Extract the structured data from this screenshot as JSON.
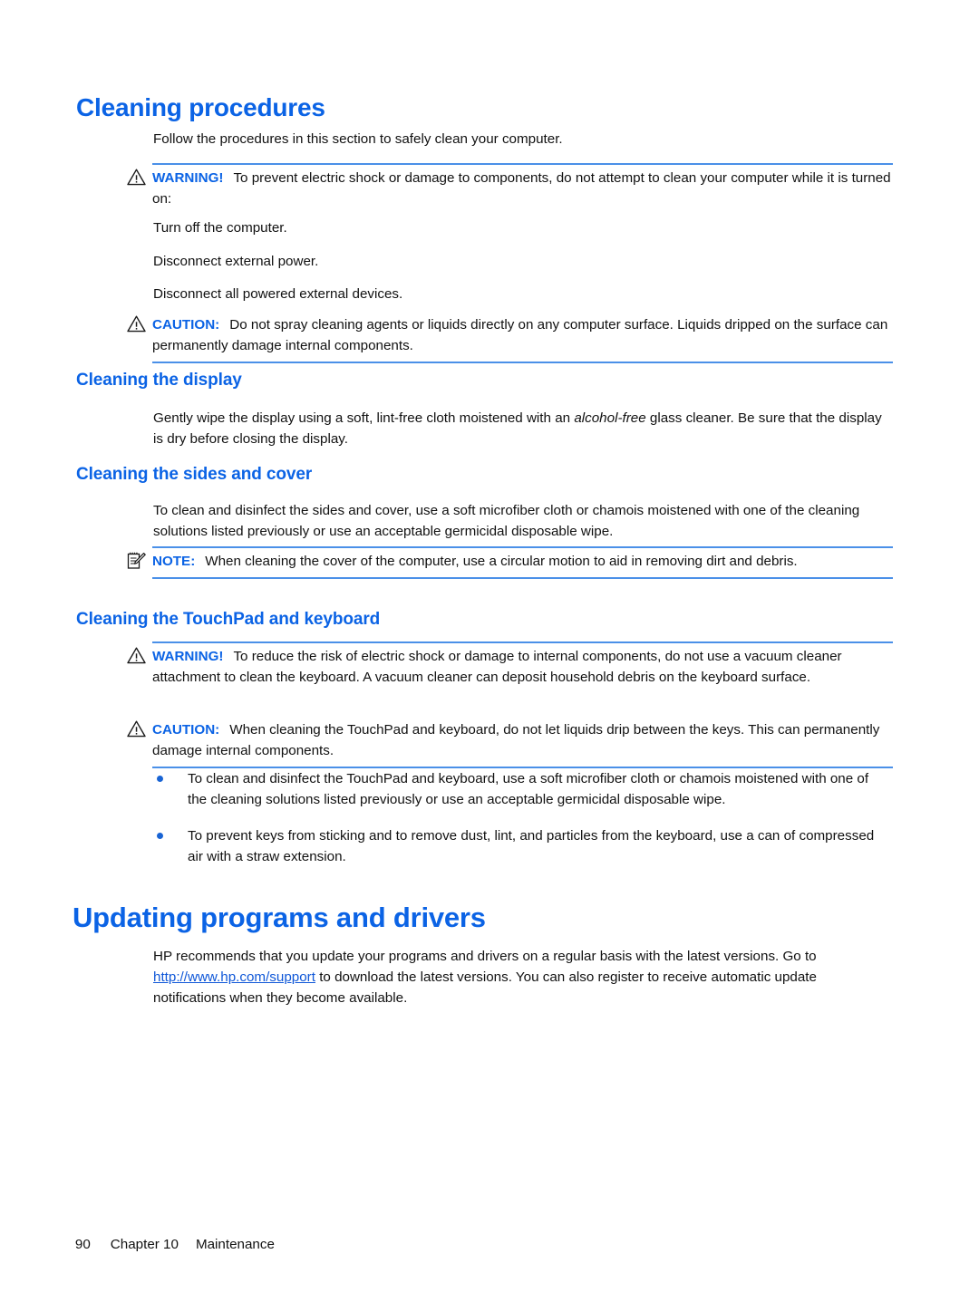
{
  "document": {
    "sections": {
      "cleaning_procedures_title": "Cleaning procedures",
      "intro": "Follow the procedures in this section to safely clean your computer.",
      "cleaning_display_title": "Cleaning the display",
      "cleaning_display_body_pre": "Gently wipe the display using a soft, lint-free cloth moistened with an ",
      "cleaning_display_body_italic": "alcohol-free",
      "cleaning_display_body_post": " glass cleaner. Be sure that the display is dry before closing the display.",
      "cleaning_sides_title": "Cleaning the sides and cover",
      "cleaning_sides_body": "To clean and disinfect the sides and cover, use a soft microfiber cloth or chamois moistened with one of the cleaning solutions listed previously or use an acceptable germicidal disposable wipe.",
      "cleaning_touchpad_title": "Cleaning the TouchPad and keyboard",
      "updating_title": "Updating programs and drivers",
      "updating_body_pre": "HP recommends that you update your programs and drivers on a regular basis with the latest versions. Go to ",
      "updating_link": "http://www.hp.com/support",
      "updating_body_post": " to download the latest versions. You can also register to receive automatic update notifications when they become available."
    },
    "admonitions": {
      "warning_1": {
        "icon": "warning-triangle-icon",
        "label": "WARNING!",
        "text": "To prevent electric shock or damage to components, do not attempt to clean your computer while it is turned on:"
      },
      "warning_1_steps": [
        "Turn off the computer.",
        "Disconnect external power.",
        "Disconnect all powered external devices."
      ],
      "caution_1": {
        "icon": "warning-triangle-icon",
        "label": "CAUTION:",
        "text": "Do not spray cleaning agents or liquids directly on any computer surface. Liquids dripped on the surface can permanently damage internal components."
      },
      "note_1": {
        "icon": "note-pad-pencil-icon",
        "label": "NOTE:",
        "text": "When cleaning the cover of the computer, use a circular motion to aid in removing dirt and debris."
      },
      "warning_2": {
        "icon": "warning-triangle-icon",
        "label": "WARNING!",
        "text": "To reduce the risk of electric shock or damage to internal components, do not use a vacuum cleaner attachment to clean the keyboard. A vacuum cleaner can deposit household debris on the keyboard surface."
      },
      "caution_2": {
        "icon": "warning-triangle-icon",
        "label": "CAUTION:",
        "text": "When cleaning the TouchPad and keyboard, do not let liquids drip between the keys. This can permanently damage internal components."
      }
    },
    "bullets": [
      "To clean and disinfect the TouchPad and keyboard, use a soft microfiber cloth or chamois moistened with one of the cleaning solutions listed previously or use an acceptable germicidal disposable wipe.",
      "To prevent keys from sticking and to remove dust, lint, and particles from the keyboard, use a can of compressed air with a straw extension."
    ],
    "footer": {
      "page_number": "90",
      "chapter": "Chapter 10",
      "chapter_title": "Maintenance"
    },
    "colors": {
      "heading_blue": "#0B63E5",
      "rule_blue": "#4A90E8",
      "link_blue": "#1058D8",
      "bullet_blue": "#1964D4",
      "body_black": "#111111"
    }
  }
}
